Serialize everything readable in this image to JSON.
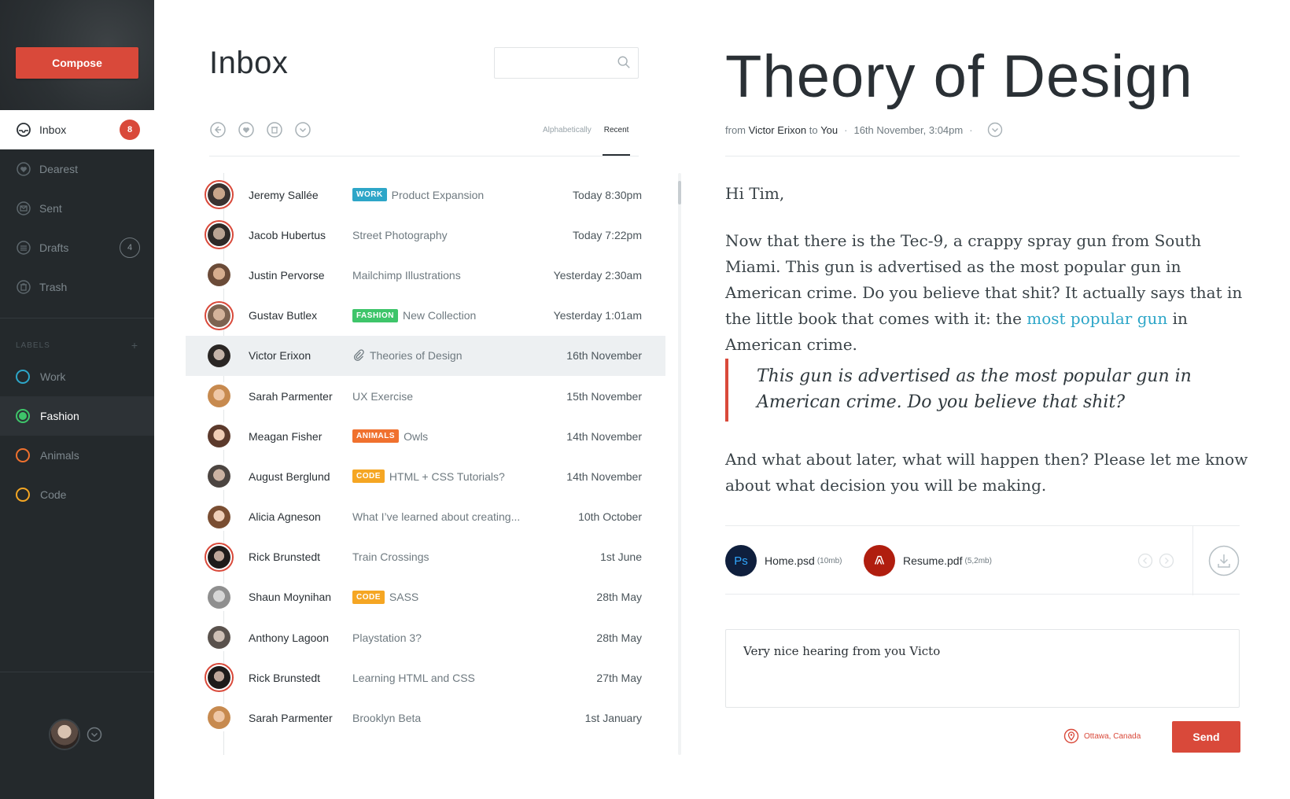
{
  "colors": {
    "accent": "#d9493a",
    "sidebar_bg": "#24292c",
    "link": "#2da6c8",
    "tag_work": "#2da6c8",
    "tag_fashion": "#3ec56a",
    "tag_animals": "#f0712e",
    "tag_code": "#f5a623"
  },
  "sidebar": {
    "compose_label": "Compose",
    "items": [
      {
        "label": "Inbox",
        "icon": "inbox-icon",
        "badge": "8"
      },
      {
        "label": "Dearest",
        "icon": "heart-icon"
      },
      {
        "label": "Sent",
        "icon": "sent-icon"
      },
      {
        "label": "Drafts",
        "icon": "drafts-icon",
        "badge": "4"
      },
      {
        "label": "Trash",
        "icon": "trash-icon"
      }
    ],
    "labels_heading": "LABELS",
    "labels_add": "+",
    "labels": [
      {
        "label": "Work",
        "color": "#2da6c8"
      },
      {
        "label": "Fashion",
        "color": "#3ec56a"
      },
      {
        "label": "Animals",
        "color": "#f0712e"
      },
      {
        "label": "Code",
        "color": "#f5a623"
      }
    ]
  },
  "list": {
    "title": "Inbox",
    "search_placeholder": "",
    "sort": {
      "alphabetically": "Alphabetically",
      "recent": "Recent"
    },
    "messages": [
      {
        "name": "Jeremy Sallée",
        "tag": "WORK",
        "subject": "Product Expansion",
        "date": "Today 8:30pm"
      },
      {
        "name": "Jacob Hubertus",
        "tag": "",
        "subject": "Street Photography",
        "date": "Today 7:22pm"
      },
      {
        "name": "Justin Pervorse",
        "tag": "",
        "subject": "Mailchimp Illustrations",
        "date": "Yesterday 2:30am"
      },
      {
        "name": "Gustav Butlex",
        "tag": "FASHION",
        "subject": "New Collection",
        "date": "Yesterday 1:01am"
      },
      {
        "name": "Victor Erixon",
        "tag": "",
        "subject": "Theories of Design",
        "date": "16th November"
      },
      {
        "name": "Sarah Parmenter",
        "tag": "",
        "subject": "UX Exercise",
        "date": "15th November"
      },
      {
        "name": "Meagan Fisher",
        "tag": "ANIMALS",
        "subject": "Owls",
        "date": "14th November"
      },
      {
        "name": "August Berglund",
        "tag": "CODE",
        "subject": "HTML + CSS Tutorials?",
        "date": "14th November"
      },
      {
        "name": "Alicia Agneson",
        "tag": "",
        "subject": "What I’ve learned about creating...",
        "date": "10th October"
      },
      {
        "name": "Rick Brunstedt",
        "tag": "",
        "subject": "Train Crossings",
        "date": "1st June"
      },
      {
        "name": "Shaun Moynihan",
        "tag": "CODE",
        "subject": "SASS",
        "date": "28th May"
      },
      {
        "name": "Anthony Lagoon",
        "tag": "",
        "subject": "Playstation 3?",
        "date": "28th May"
      },
      {
        "name": "Rick Brunstedt",
        "tag": "",
        "subject": "Learning HTML and CSS",
        "date": "27th May"
      },
      {
        "name": "Sarah Parmenter",
        "tag": "",
        "subject": "Brooklyn Beta",
        "date": "1st January"
      }
    ]
  },
  "reader": {
    "title": "Theory of Design",
    "meta": {
      "from": "from",
      "sender": "Victor Erixon",
      "to": "to",
      "recipient": "You",
      "date": "16th November, 3:04pm"
    },
    "greeting": "Hi Tim,",
    "para1_before": "Now that there is the Tec-9, a crappy spray gun from South Miami. This gun is advertised as the most popular gun in American crime. Do you believe that shit? It actually says that in the little book that comes with it: the ",
    "para1_link": "most popular gun",
    "para1_after": " in American crime.",
    "quote": "This gun is advertised as the most popular gun in American crime. Do you believe that shit?",
    "para2": "And what about later, what will happen then? Please let me know about what decision you will be making.",
    "attachments": [
      {
        "icon_text": "Ps",
        "name": "Home.psd",
        "size": "(10mb)"
      },
      {
        "icon_text": "",
        "name": "Resume.pdf",
        "size": "(5,2mb)"
      }
    ],
    "reply_value": "Very nice hearing from you Victo",
    "location": "Ottawa, Canada",
    "send_label": "Send"
  }
}
